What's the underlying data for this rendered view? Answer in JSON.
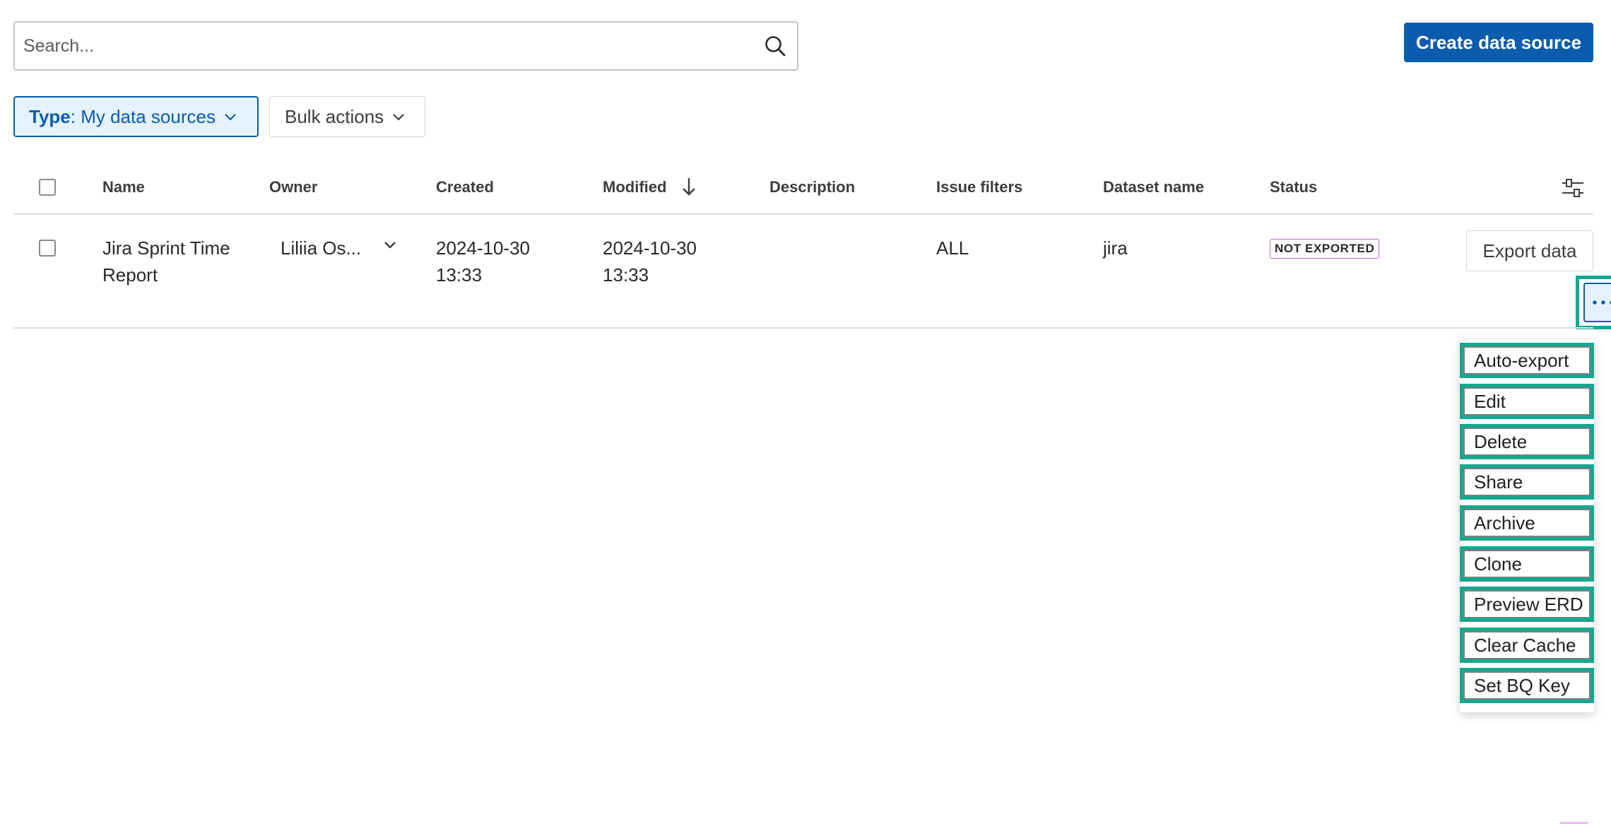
{
  "search": {
    "placeholder": "Search..."
  },
  "actions": {
    "create_label": "Create data source"
  },
  "filters": {
    "type_key": "Type",
    "type_value": "My data sources",
    "bulk_label": "Bulk actions"
  },
  "table": {
    "columns": {
      "name": "Name",
      "owner": "Owner",
      "created": "Created",
      "modified": "Modified",
      "description": "Description",
      "issue_filters": "Issue filters",
      "dataset_name": "Dataset name",
      "status": "Status"
    },
    "sort_column": "Modified",
    "rows": [
      {
        "name_line1": "Jira Sprint Time",
        "name_line2": "Report",
        "owner": "Liliia Os...",
        "created_date": "2024-10-30",
        "created_time": "13:33",
        "modified_date": "2024-10-30",
        "modified_time": "13:33",
        "description": "",
        "issue_filters": "ALL",
        "dataset_name": "jira",
        "status": "NOT EXPORTED",
        "export_label": "Export data"
      }
    ]
  },
  "menu": {
    "items": [
      "Auto-export",
      "Edit",
      "Delete",
      "Share",
      "Archive",
      "Clone",
      "Preview ERD",
      "Clear Cache",
      "Set BQ Key"
    ]
  },
  "colors": {
    "primary": "#0b5cad",
    "primary_light": "#e5f2fb",
    "highlight": "#14a890",
    "status_border": "#c263c9"
  }
}
